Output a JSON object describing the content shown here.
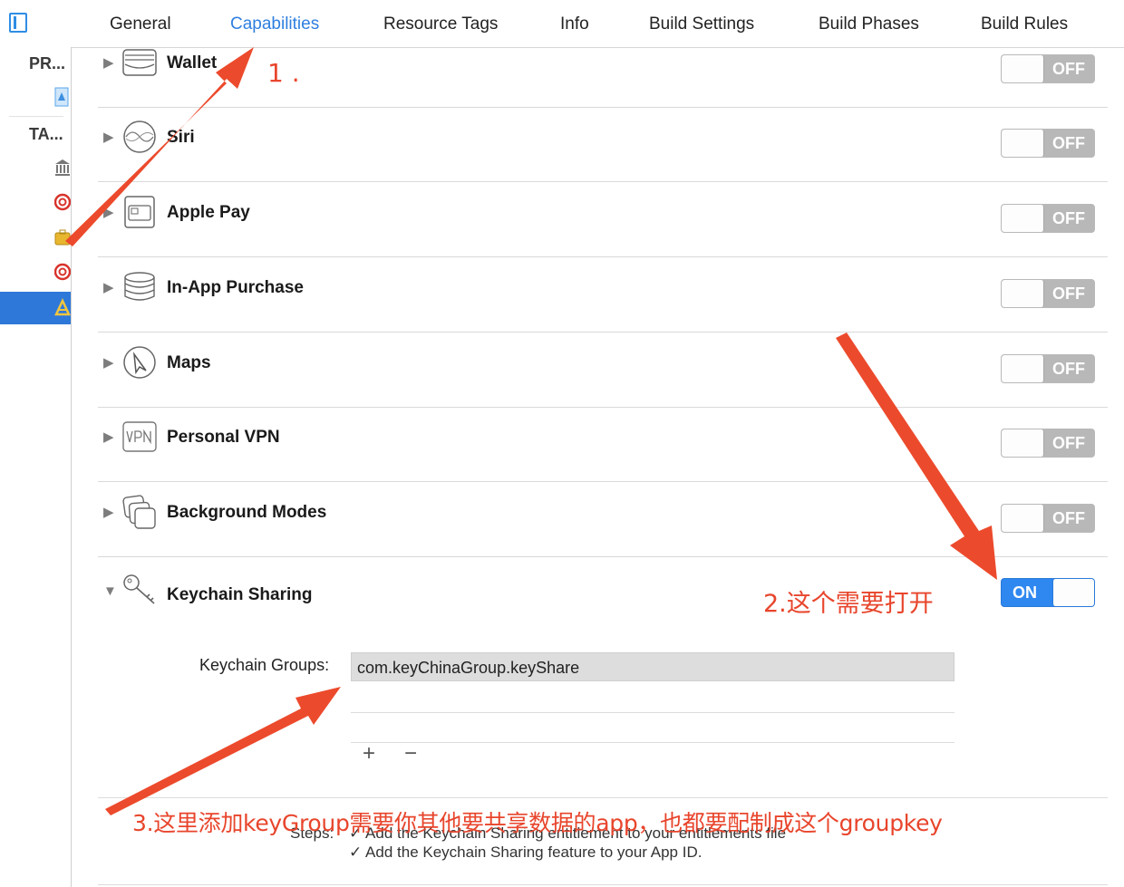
{
  "tabs": [
    {
      "label": "General"
    },
    {
      "label": "Capabilities",
      "active": true
    },
    {
      "label": "Resource Tags"
    },
    {
      "label": "Info"
    },
    {
      "label": "Build Settings"
    },
    {
      "label": "Build Phases"
    },
    {
      "label": "Build Rules"
    }
  ],
  "sidebar": {
    "project_header": "PR...",
    "targets_header": "TA..."
  },
  "capabilities": [
    {
      "name": "Wallet",
      "icon": "wallet-icon",
      "state": "OFF"
    },
    {
      "name": "Siri",
      "icon": "siri-icon",
      "state": "OFF"
    },
    {
      "name": "Apple Pay",
      "icon": "apple-pay-icon",
      "state": "OFF"
    },
    {
      "name": "In-App Purchase",
      "icon": "in-app-purchase-icon",
      "state": "OFF"
    },
    {
      "name": "Maps",
      "icon": "maps-icon",
      "state": "OFF"
    },
    {
      "name": "Personal VPN",
      "icon": "vpn-icon",
      "state": "OFF"
    },
    {
      "name": "Background Modes",
      "icon": "background-modes-icon",
      "state": "OFF"
    },
    {
      "name": "Keychain Sharing",
      "icon": "keychain-icon",
      "state": "ON"
    }
  ],
  "keychain": {
    "groups_label": "Keychain Groups:",
    "group_value": "com.keyChinaGroup.keyShare",
    "add_label": "+",
    "remove_label": "−",
    "steps_label": "Steps:",
    "steps": [
      "Add the Keychain Sharing entitlement to your entitlements file",
      "Add the Keychain Sharing feature to your App ID."
    ]
  },
  "annotations": {
    "a1": "1 .",
    "a2": "2.这个需要打开",
    "a3": "3.这里添加keyGroup需要你其他要共享数据的app，也都要配制成这个groupkey"
  },
  "colors": {
    "accent": "#2f7fe0",
    "toggle_on": "#2f87f0",
    "annotation": "#e8452c"
  }
}
